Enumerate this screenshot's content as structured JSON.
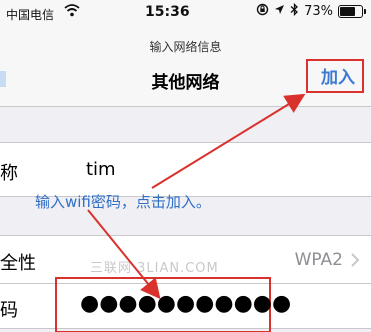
{
  "status_bar": {
    "carrier": "中国电信",
    "time": "15:36",
    "battery_percent_text": "73%",
    "battery_level": 0.73
  },
  "nav": {
    "prompt": "输入网络信息",
    "title": "其他网络",
    "join_label": "加入"
  },
  "form": {
    "name_label": "称",
    "name_value": "tim",
    "security_label": "全性",
    "security_value": "WPA2",
    "password_label": "码",
    "password_value": "●●●●●●●●●●●"
  },
  "annotation": {
    "text": "输入wifi密码，点击加入。",
    "color": "#2f6fc6",
    "highlight_color": "#d9312c",
    "arrow_color": "#d9312c"
  },
  "watermark": "三联网 3LIAN.COM",
  "icons": [
    "wifi-icon",
    "lock-rotation-icon",
    "location-arrow-icon",
    "bluetooth-icon",
    "battery-icon",
    "chevron-right-icon"
  ]
}
